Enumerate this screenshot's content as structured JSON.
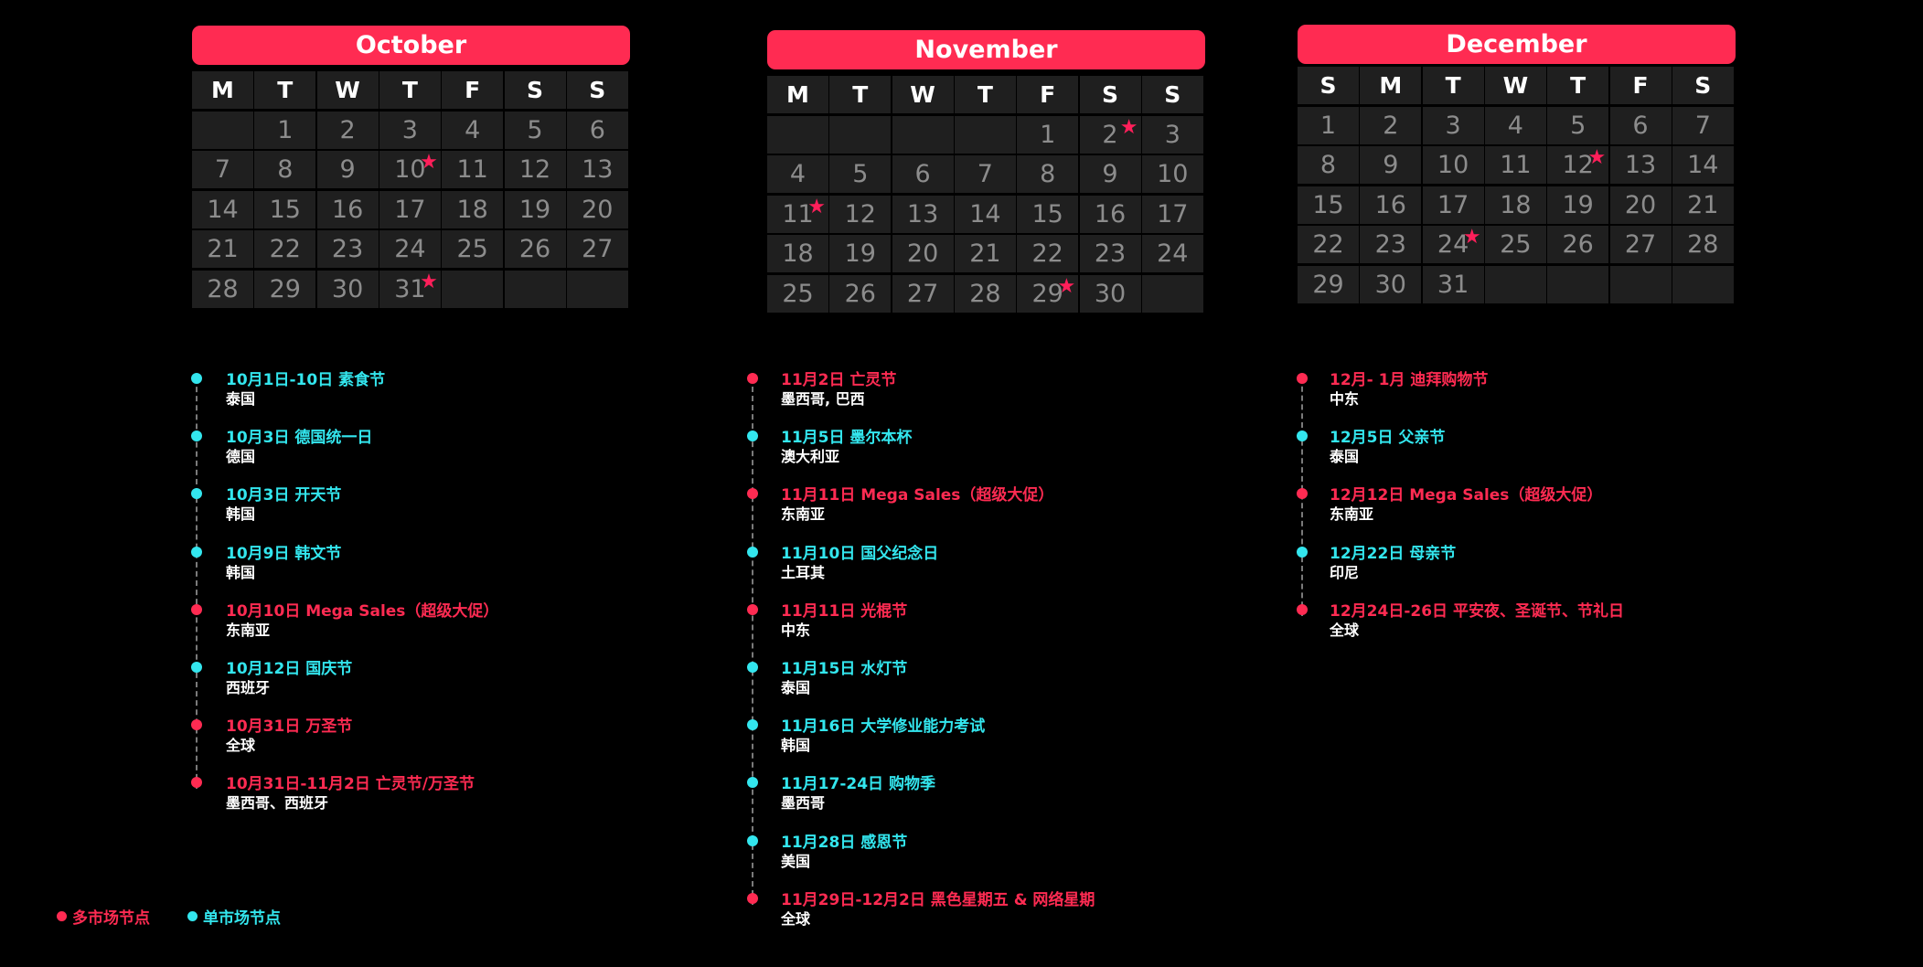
{
  "colors": {
    "multi": "#ff2b52",
    "single": "#33e6ee",
    "header": "#ff2b52"
  },
  "calendars": [
    {
      "month": "October",
      "dow": [
        "M",
        "T",
        "W",
        "T",
        "F",
        "S",
        "S"
      ],
      "offset": 1,
      "days": 31,
      "rows": 5,
      "stars": [
        10,
        31
      ]
    },
    {
      "month": "November",
      "dow": [
        "M",
        "T",
        "W",
        "T",
        "F",
        "S",
        "S"
      ],
      "offset": 4,
      "days": 30,
      "rows": 5,
      "stars": [
        2,
        11,
        29
      ]
    },
    {
      "month": "December",
      "dow": [
        "S",
        "M",
        "T",
        "W",
        "T",
        "F",
        "S"
      ],
      "offset": 0,
      "days": 31,
      "rows": 5,
      "stars": [
        12,
        24
      ]
    }
  ],
  "timelines": [
    [
      {
        "title": "10月1日-10日 素食节",
        "sub": "泰国",
        "kind": "single"
      },
      {
        "title": "10月3日 德国统一日",
        "sub": "德国",
        "kind": "single"
      },
      {
        "title": "10月3日 开天节",
        "sub": "韩国",
        "kind": "single"
      },
      {
        "title": "10月9日 韩文节",
        "sub": "韩国",
        "kind": "single"
      },
      {
        "title": "10月10日 Mega Sales（超级大促）",
        "sub": "东南亚",
        "kind": "multi"
      },
      {
        "title": "10月12日 国庆节",
        "sub": "西班牙",
        "kind": "single"
      },
      {
        "title": "10月31日 万圣节",
        "sub": "全球",
        "kind": "multi"
      },
      {
        "title": "10月31日-11月2日 亡灵节/万圣节",
        "sub": "墨西哥、西班牙",
        "kind": "multi"
      }
    ],
    [
      {
        "title": "11月2日 亡灵节",
        "sub": "墨西哥, 巴西",
        "kind": "multi"
      },
      {
        "title": "11月5日 墨尔本杯",
        "sub": "澳大利亚",
        "kind": "single"
      },
      {
        "title": "11月11日 Mega Sales（超级大促）",
        "sub": "东南亚",
        "kind": "multi"
      },
      {
        "title": "11月10日 国父纪念日",
        "sub": "土耳其",
        "kind": "single"
      },
      {
        "title": "11月11日 光棍节",
        "sub": "中东",
        "kind": "multi"
      },
      {
        "title": "11月15日 水灯节",
        "sub": "泰国",
        "kind": "single"
      },
      {
        "title": "11月16日 大学修业能力考试",
        "sub": "韩国",
        "kind": "single"
      },
      {
        "title": "11月17-24日 购物季",
        "sub": "墨西哥",
        "kind": "single"
      },
      {
        "title": "11月28日 感恩节",
        "sub": "美国",
        "kind": "single"
      },
      {
        "title": "11月29日-12月2日 黑色星期五 & 网络星期",
        "sub": "全球",
        "kind": "multi"
      }
    ],
    [
      {
        "title": "12月- 1月 迪拜购物节",
        "sub": "中东",
        "kind": "multi"
      },
      {
        "title": "12月5日 父亲节",
        "sub": "泰国",
        "kind": "single"
      },
      {
        "title": "12月12日 Mega Sales（超级大促）",
        "sub": "东南亚",
        "kind": "multi"
      },
      {
        "title": "12月22日 母亲节",
        "sub": "印尼",
        "kind": "single"
      },
      {
        "title": "12月24日-26日 平安夜、圣诞节、节礼日",
        "sub": "全球",
        "kind": "multi"
      }
    ]
  ],
  "legend": [
    {
      "label": "多市场节点",
      "kind": "multi"
    },
    {
      "label": "单市场节点",
      "kind": "single"
    }
  ]
}
